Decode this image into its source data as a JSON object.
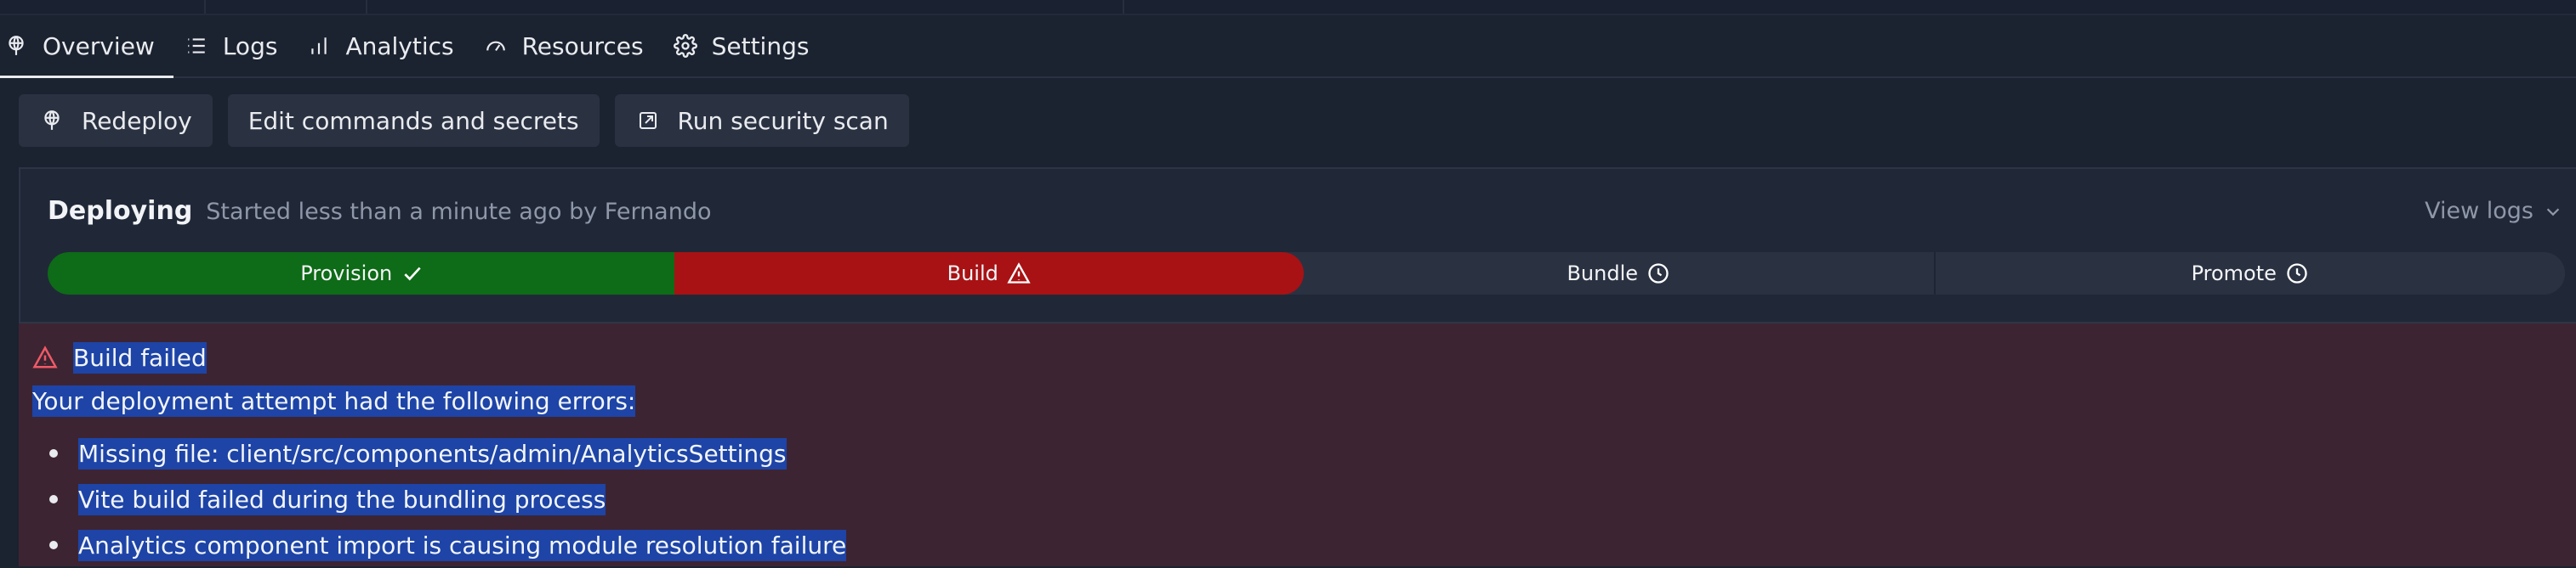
{
  "tabs": [
    {
      "label": "Overview",
      "icon": "deploy-balloon-icon",
      "active": true
    },
    {
      "label": "Logs",
      "icon": "list-icon",
      "active": false
    },
    {
      "label": "Analytics",
      "icon": "bar-chart-icon",
      "active": false
    },
    {
      "label": "Resources",
      "icon": "gauge-icon",
      "active": false
    },
    {
      "label": "Settings",
      "icon": "gear-icon",
      "active": false
    }
  ],
  "toolbar": {
    "redeploy": "Redeploy",
    "edit": "Edit commands and secrets",
    "scan": "Run security scan"
  },
  "deploy": {
    "status": "Deploying",
    "subtitle": "Started less than a minute ago by Fernando",
    "view_logs": "View logs"
  },
  "stages": [
    {
      "label": "Provision",
      "state": "success",
      "icon": "check-icon"
    },
    {
      "label": "Build",
      "state": "failed",
      "icon": "warning-icon"
    },
    {
      "label": "Bundle",
      "state": "pending",
      "icon": "clock-icon"
    },
    {
      "label": "Promote",
      "state": "pending",
      "icon": "clock-icon"
    }
  ],
  "colors": {
    "success": "#0e6b17",
    "failed": "#a81214",
    "pending": "#2a3242",
    "error_bg": "#3d2432",
    "selection": "#1d44a6"
  },
  "error": {
    "title": "Build failed",
    "intro": "Your deployment attempt had the following errors:",
    "items": [
      "Missing file: client/src/components/admin/AnalyticsSettings",
      "Vite build failed during the bundling process",
      "Analytics component import is causing module resolution failure"
    ]
  }
}
